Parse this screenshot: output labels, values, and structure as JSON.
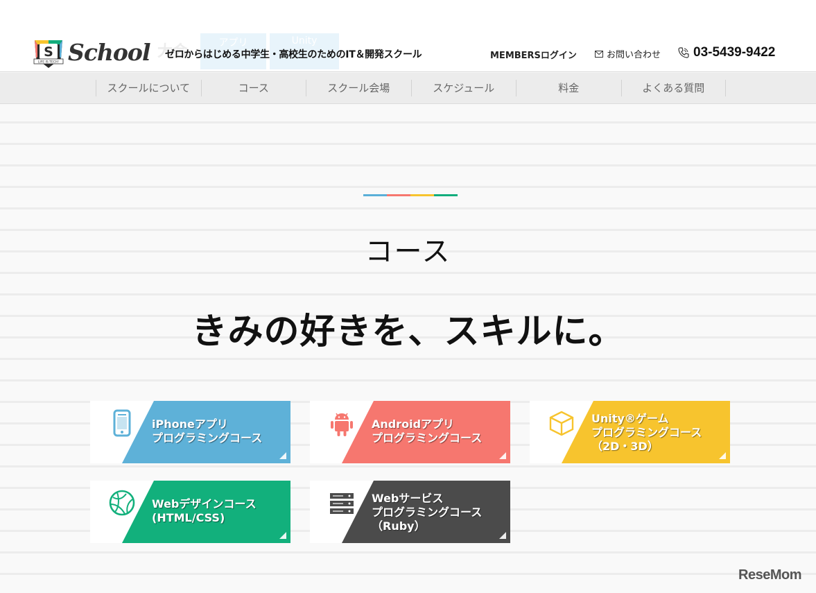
{
  "header": {
    "ghost_tabs": [
      "アプリ",
      "Unity"
    ],
    "ghost_text": "大会",
    "tagline": "ゼロからはじめる中学生・高校生のためのIT＆開発スクール",
    "members_login": "MEMBERSログイン",
    "contact": "お問い合わせ",
    "phone": "03-5439-9422",
    "logo": {
      "letter": "S",
      "ribbon": "LIFE IS TECH!",
      "word": "School"
    }
  },
  "nav": {
    "items": [
      "スクールについて",
      "コース",
      "スクール会場",
      "スケジュール",
      "料金",
      "よくある質問"
    ]
  },
  "main": {
    "accent_colors": [
      "#5aafd8",
      "#f6776f",
      "#f7c42e",
      "#12ad7d"
    ],
    "section_title": "コース",
    "catchphrase": "きみの好きを、スキルに。"
  },
  "courses": [
    {
      "lines": [
        "iPhoneアプリ",
        "プログラミングコース"
      ],
      "color": "#5eb1d8",
      "icon": "iphone-icon"
    },
    {
      "lines": [
        "Androidアプリ",
        "プログラミングコース"
      ],
      "color": "#f6776f",
      "icon": "android-icon"
    },
    {
      "lines": [
        "Unity®ゲーム",
        "プログラミングコース",
        "（2D・3D）"
      ],
      "color": "#f7c42e",
      "icon": "cube-icon"
    },
    {
      "lines": [
        "Webデザインコース",
        "(HTML/CSS)"
      ],
      "color": "#12b07c",
      "icon": "globe-icon"
    },
    {
      "lines": [
        "Webサービス",
        "プログラミングコース",
        "（Ruby）"
      ],
      "color": "#4b4b4b",
      "icon": "server-icon"
    }
  ],
  "watermark": "ReseMom"
}
